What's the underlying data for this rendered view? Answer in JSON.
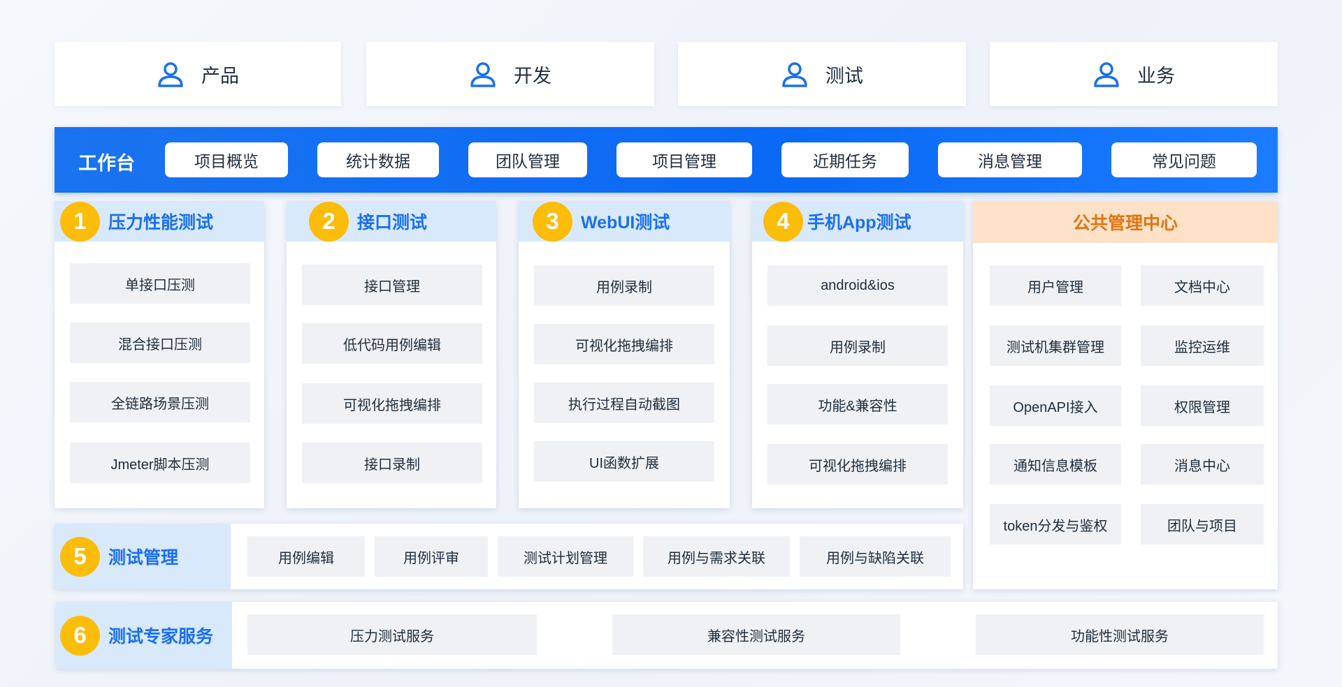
{
  "roles": [
    "产品",
    "开发",
    "测试",
    "业务"
  ],
  "workbench": {
    "title": "工作台",
    "buttons": [
      "项目概览",
      "统计数据",
      "团队管理",
      "项目管理",
      "近期任务",
      "消息管理",
      "常见问题"
    ]
  },
  "modules": [
    {
      "num": "1",
      "title": "压力性能测试",
      "items": [
        "单接口压测",
        "混合接口压测",
        "全链路场景压测",
        "Jmeter脚本压测"
      ]
    },
    {
      "num": "2",
      "title": "接口测试",
      "items": [
        "接口管理",
        "低代码用例编辑",
        "可视化拖拽编排",
        "接口录制"
      ]
    },
    {
      "num": "3",
      "title": "WebUI测试",
      "items": [
        "用例录制",
        "可视化拖拽编排",
        "执行过程自动截图",
        "UI函数扩展"
      ]
    },
    {
      "num": "4",
      "title": "手机App测试",
      "items": [
        "android&ios",
        "用例录制",
        "功能&兼容性",
        "可视化拖拽编排"
      ]
    }
  ],
  "public_center": {
    "title": "公共管理中心",
    "items": [
      "用户管理",
      "文档中心",
      "测试机集群管理",
      "监控运维",
      "OpenAPI接入",
      "权限管理",
      "通知信息模板",
      "消息中心",
      "token分发与鉴权",
      "团队与项目"
    ]
  },
  "test_management": {
    "num": "5",
    "title": "测试管理",
    "items": [
      "用例编辑",
      "用例评审",
      "测试计划管理",
      "用例与需求关联",
      "用例与缺陷关联"
    ]
  },
  "expert_service": {
    "num": "6",
    "title": "测试专家服务",
    "items": [
      "压力测试服务",
      "兼容性测试服务",
      "功能性测试服务"
    ]
  },
  "colors": {
    "accent": "#1a6ff2",
    "badge": "#fbbd0a",
    "public_title": "#e3740f"
  }
}
